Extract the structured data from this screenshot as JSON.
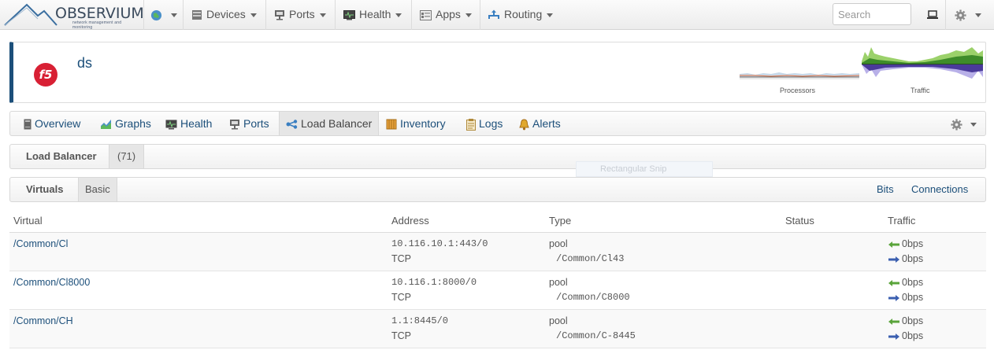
{
  "navbar": {
    "logo_text": "OBSERVIUM",
    "logo_sub": "network management and monitoring",
    "items": [
      {
        "label": "Devices",
        "icon": "server-icon"
      },
      {
        "label": "Ports",
        "icon": "network-port-icon"
      },
      {
        "label": "Health",
        "icon": "health-monitor-icon"
      },
      {
        "label": "Apps",
        "icon": "apps-grid-icon"
      },
      {
        "label": "Routing",
        "icon": "routing-icon"
      }
    ],
    "search_placeholder": "Search"
  },
  "device": {
    "name": "ds",
    "subtitle": "",
    "logo_text": "f5",
    "graph_labels": [
      "Processors",
      "Traffic"
    ]
  },
  "tabs": [
    {
      "label": "Overview",
      "icon": "overview-icon"
    },
    {
      "label": "Graphs",
      "icon": "graphs-icon"
    },
    {
      "label": "Health",
      "icon": "health-icon"
    },
    {
      "label": "Ports",
      "icon": "ports-icon"
    },
    {
      "label": "Load Balancer",
      "icon": "share-icon",
      "active": true
    },
    {
      "label": "Inventory",
      "icon": "inventory-icon"
    },
    {
      "label": "Logs",
      "icon": "logs-icon"
    },
    {
      "label": "Alerts",
      "icon": "bell-icon"
    }
  ],
  "lb_bar": {
    "title": "Load Balancer",
    "count": "(71)"
  },
  "snip_ghost": "Rectangular Snip",
  "virtuals_bar": {
    "title": "Virtuals",
    "basic": "Basic",
    "bits": "Bits",
    "connections": "Connections"
  },
  "table": {
    "headers": [
      "Virtual",
      "Address",
      "Type",
      "Status",
      "Traffic"
    ],
    "rows": [
      {
        "virtual": "/Common/Cl",
        "address": "10.116.10.1:443/0",
        "proto": "TCP",
        "type": "pool",
        "pool": "/Common/Cl43",
        "in": "0bps",
        "out": "0bps"
      },
      {
        "virtual": "/Common/Cl8000",
        "address": "10.116.1:8000/0",
        "proto": "TCP",
        "type": "pool",
        "pool": "/Common/C8000",
        "in": "0bps",
        "out": "0bps"
      },
      {
        "virtual": "/Common/CH",
        "address": "1.1:8445/0",
        "proto": "TCP",
        "type": "pool",
        "pool": "/Common/C-8445",
        "in": "0bps",
        "out": "0bps"
      }
    ]
  },
  "colors": {
    "brand": "#1c4f7a",
    "f5_red": "#d82034",
    "in_arrow": "#5aa43b",
    "out_arrow": "#3b5fb0"
  }
}
